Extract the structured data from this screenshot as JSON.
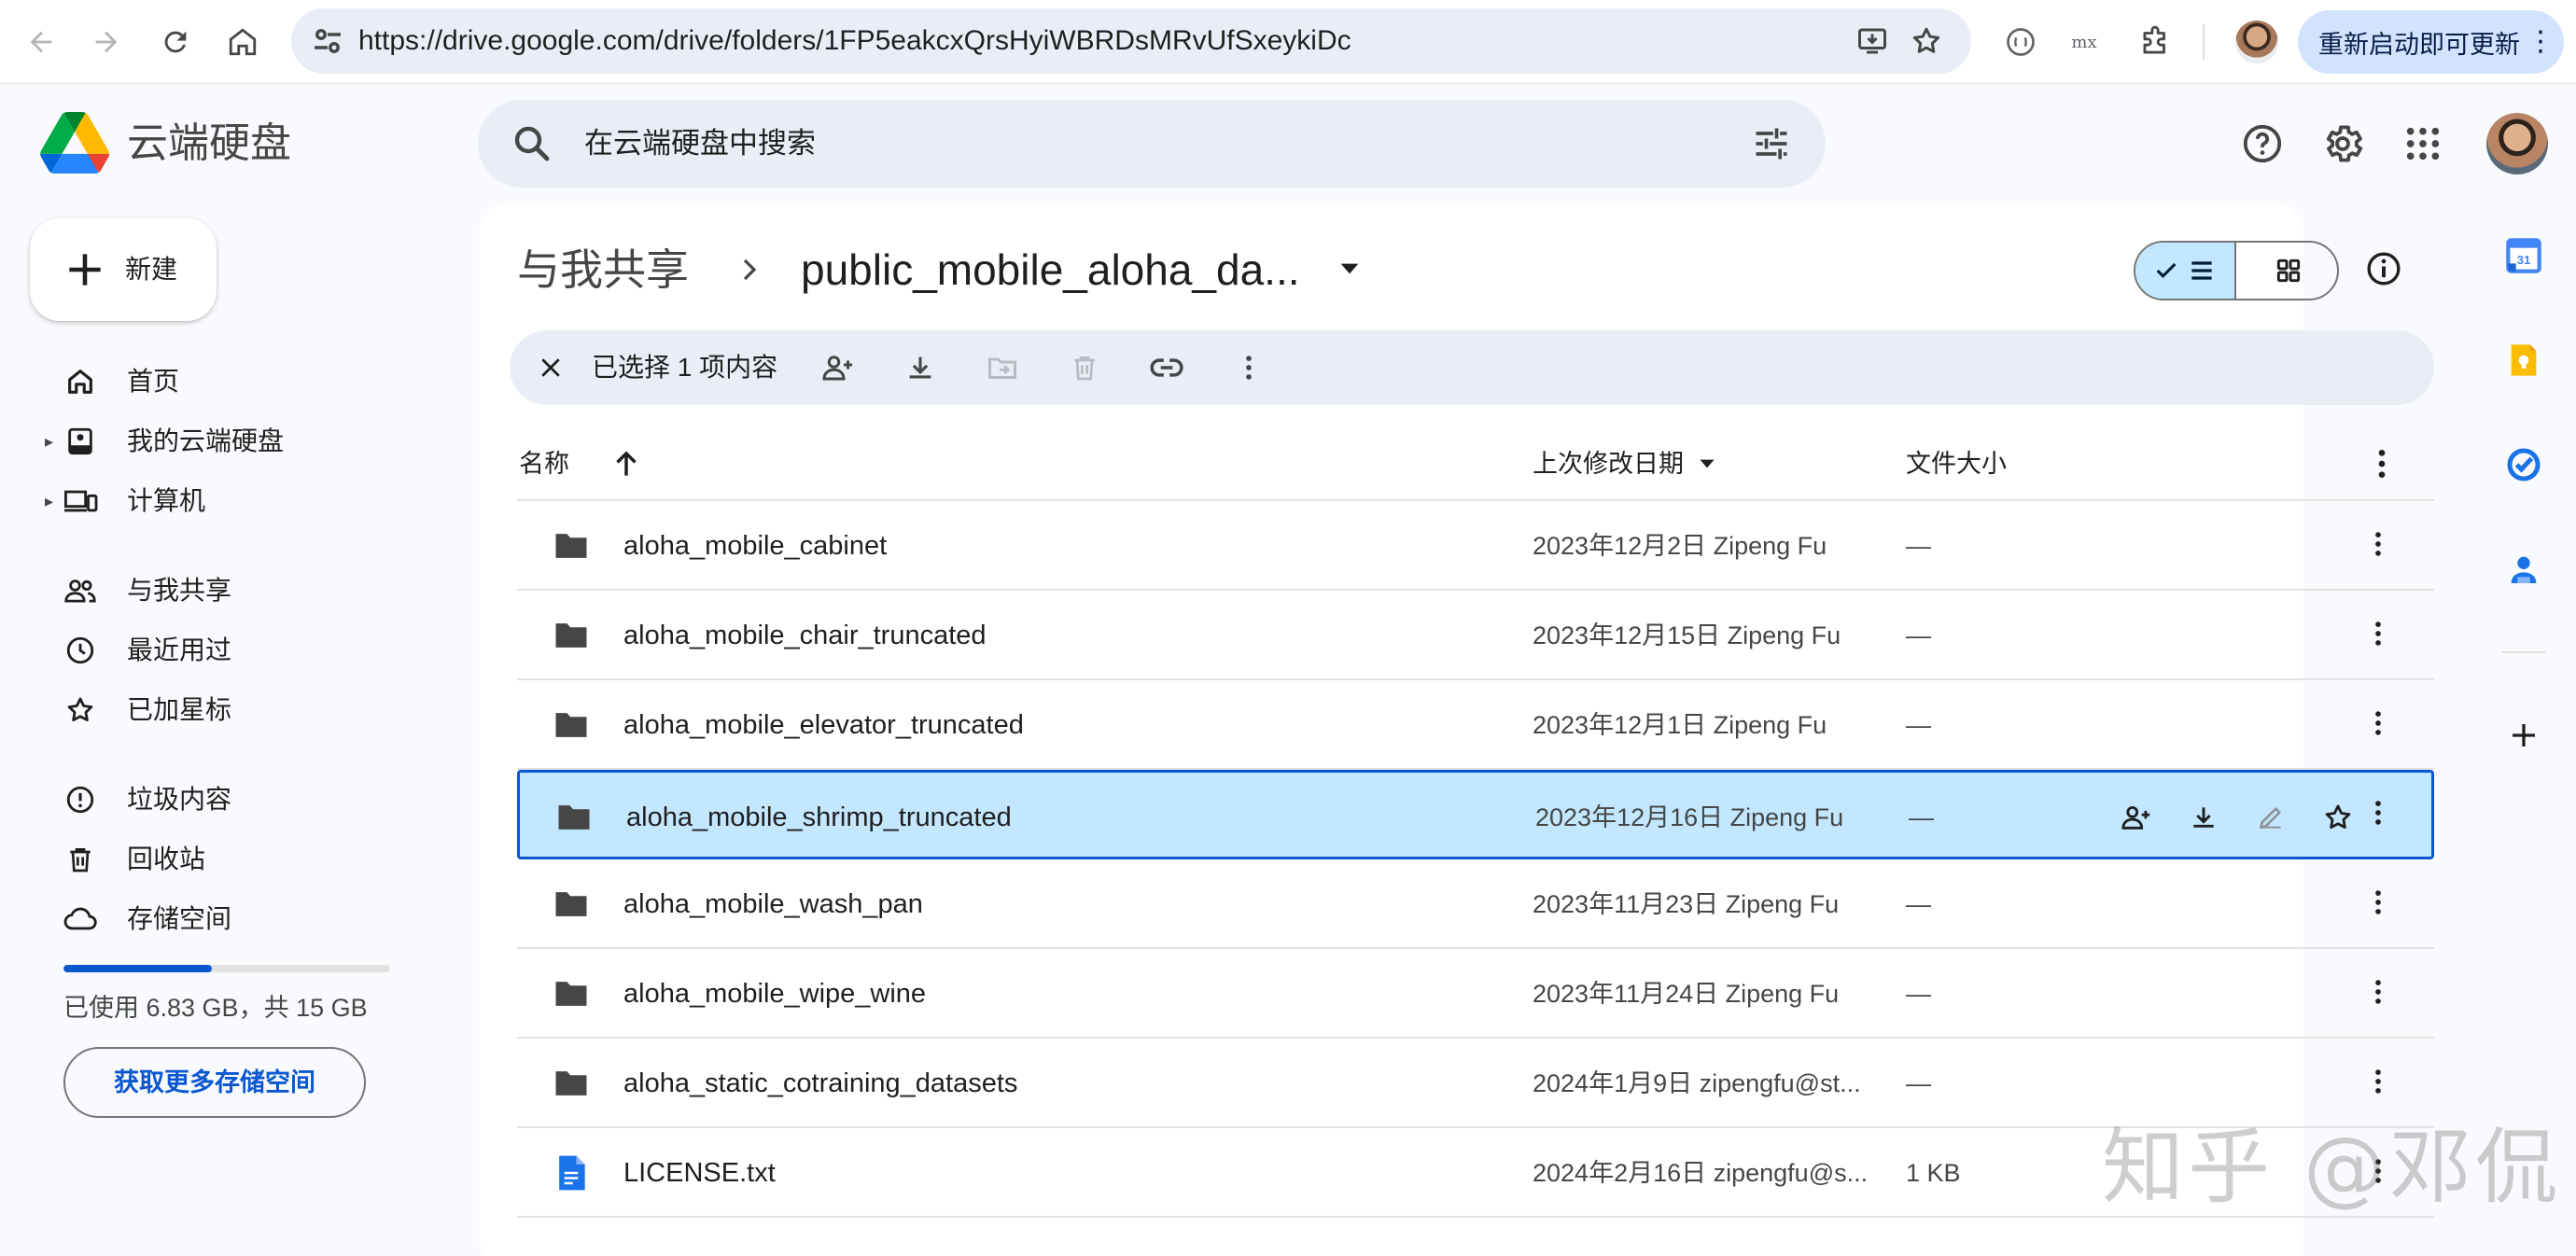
{
  "browser": {
    "url": "https://drive.google.com/drive/folders/1FP5eakcxQrsHyiWBRDsMRvUfSxeykiDc",
    "update_button_label": "重新启动即可更新",
    "ext_tex_label": "mx"
  },
  "app": {
    "title": "云端硬盘",
    "search_placeholder": "在云端硬盘中搜索"
  },
  "sidebar": {
    "new_button_label": "新建",
    "items": [
      {
        "label": "首页",
        "icon": "home-icon"
      },
      {
        "label": "我的云端硬盘",
        "icon": "my-drive-icon"
      },
      {
        "label": "计算机",
        "icon": "computers-icon"
      },
      {
        "label": "与我共享",
        "icon": "shared-icon"
      },
      {
        "label": "最近用过",
        "icon": "clock-icon"
      },
      {
        "label": "已加星标",
        "icon": "star-icon"
      },
      {
        "label": "垃圾内容",
        "icon": "spam-icon"
      },
      {
        "label": "回收站",
        "icon": "trash-icon"
      },
      {
        "label": "存储空间",
        "icon": "cloud-icon"
      }
    ],
    "storage": {
      "used_fraction": 0.455,
      "text": "已使用 6.83 GB，共 15 GB",
      "button_label": "获取更多存储空间"
    }
  },
  "breadcrumb": {
    "parent": "与我共享",
    "current": "public_mobile_aloha_da..."
  },
  "selection_bar": {
    "count_text": "已选择 1 项内容"
  },
  "table": {
    "headers": {
      "name": "名称",
      "modified": "上次修改日期",
      "size": "文件大小"
    },
    "rows": [
      {
        "type": "folder",
        "name": "aloha_mobile_cabinet",
        "modified": "2023年12月2日 Zipeng Fu",
        "size": "—",
        "selected": false
      },
      {
        "type": "folder",
        "name": "aloha_mobile_chair_truncated",
        "modified": "2023年12月15日 Zipeng Fu",
        "size": "—",
        "selected": false
      },
      {
        "type": "folder",
        "name": "aloha_mobile_elevator_truncated",
        "modified": "2023年12月1日 Zipeng Fu",
        "size": "—",
        "selected": false
      },
      {
        "type": "folder",
        "name": "aloha_mobile_shrimp_truncated",
        "modified": "2023年12月16日 Zipeng Fu",
        "size": "—",
        "selected": true
      },
      {
        "type": "folder",
        "name": "aloha_mobile_wash_pan",
        "modified": "2023年11月23日 Zipeng Fu",
        "size": "—",
        "selected": false
      },
      {
        "type": "folder",
        "name": "aloha_mobile_wipe_wine",
        "modified": "2023年11月24日 Zipeng Fu",
        "size": "—",
        "selected": false
      },
      {
        "type": "folder",
        "name": "aloha_static_cotraining_datasets",
        "modified": "2024年1月9日 zipengfu@st...",
        "size": "—",
        "selected": false
      },
      {
        "type": "file",
        "name": "LICENSE.txt",
        "modified": "2024年2月16日 zipengfu@s...",
        "size": "1 KB",
        "selected": false
      }
    ]
  },
  "side_panel": {
    "calendar_day": "31"
  },
  "colors": {
    "accent": "#0b57d0",
    "selected_row": "#c2e7ff",
    "surface": "#e9eef6",
    "update_button": "#d3e3fd"
  },
  "watermark": "知乎 @邓侃"
}
